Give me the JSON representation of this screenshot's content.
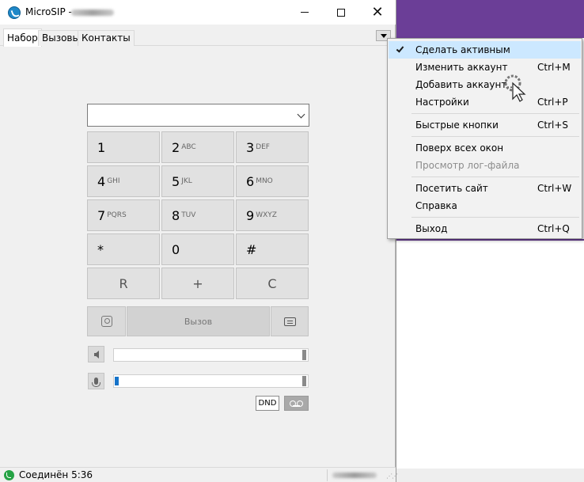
{
  "window": {
    "title": "MicroSIP -",
    "controls": {
      "minimize": "minimize",
      "maximize": "maximize",
      "close": "✕"
    }
  },
  "tabs": [
    {
      "label": "Набор",
      "active": true
    },
    {
      "label": "Вызовы",
      "active": false
    },
    {
      "label": "Контакты",
      "active": false
    }
  ],
  "dial": {
    "value": "",
    "placeholder": ""
  },
  "keypad": [
    {
      "digit": "1",
      "letters": ""
    },
    {
      "digit": "2",
      "letters": "ABC"
    },
    {
      "digit": "3",
      "letters": "DEF"
    },
    {
      "digit": "4",
      "letters": "GHI"
    },
    {
      "digit": "5",
      "letters": "JKL"
    },
    {
      "digit": "6",
      "letters": "MNO"
    },
    {
      "digit": "7",
      "letters": "PQRS"
    },
    {
      "digit": "8",
      "letters": "TUV"
    },
    {
      "digit": "9",
      "letters": "WXYZ"
    },
    {
      "digit": "*",
      "letters": ""
    },
    {
      "digit": "0",
      "letters": ""
    },
    {
      "digit": "#",
      "letters": ""
    }
  ],
  "functions": {
    "redial": "R",
    "plus": "+",
    "clear": "C"
  },
  "call": {
    "label": "Вызов"
  },
  "volume": {
    "speaker_level": 0,
    "microphone_level": 0.02
  },
  "buttons": {
    "dnd": "DND"
  },
  "status": {
    "text": "Соединён 5:36"
  },
  "menu": {
    "items": [
      {
        "label": "Сделать активным",
        "shortcut": "",
        "checked": true,
        "disabled": false
      },
      {
        "label": "Изменить аккаунт",
        "shortcut": "Ctrl+M",
        "checked": false,
        "disabled": false
      },
      {
        "label": "Добавить аккаунт...",
        "shortcut": "",
        "checked": false,
        "disabled": false
      },
      {
        "label": "Настройки",
        "shortcut": "Ctrl+P",
        "checked": false,
        "disabled": false
      },
      {
        "label": "Быстрые кнопки",
        "shortcut": "Ctrl+S",
        "checked": false,
        "disabled": false
      },
      {
        "label": "Поверх всех окон",
        "shortcut": "",
        "checked": false,
        "disabled": false
      },
      {
        "label": "Просмотр лог-файла",
        "shortcut": "",
        "checked": false,
        "disabled": true
      },
      {
        "label": "Посетить сайт",
        "shortcut": "Ctrl+W",
        "checked": false,
        "disabled": false
      },
      {
        "label": "Справка",
        "shortcut": "",
        "checked": false,
        "disabled": false
      },
      {
        "label": "Выход",
        "shortcut": "Ctrl+Q",
        "checked": false,
        "disabled": false
      }
    ]
  },
  "colors": {
    "accent_blue": "#1673c9",
    "menu_highlight": "#cce8ff",
    "background_app_purple": "#6b3e97",
    "status_green": "#25a244"
  }
}
